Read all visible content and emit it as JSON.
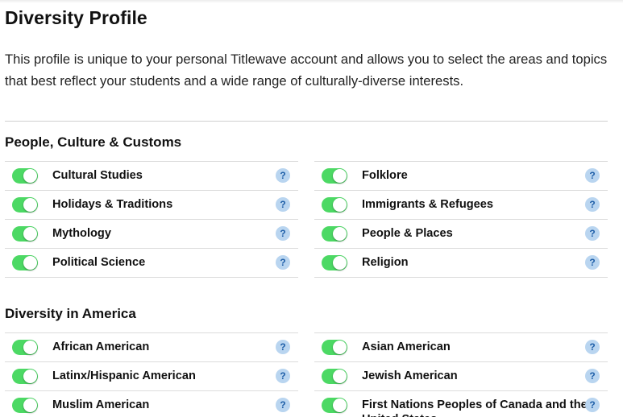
{
  "page": {
    "title": "Diversity Profile",
    "intro": "This profile is unique to your personal Titlewave account and allows you to select the areas and topics that best reflect your students and a wide range of culturally-diverse interests."
  },
  "colors": {
    "toggle_on": "#4cd964",
    "help_bg": "#b9d5f0",
    "help_fg": "#1f5fa8"
  },
  "icons": {
    "toggle": "toggle-switch-on",
    "help": "question-mark-icon"
  },
  "sections": [
    {
      "title": "People, Culture & Customs",
      "items": [
        {
          "label": "Cultural Studies",
          "enabled": true,
          "help": "?"
        },
        {
          "label": "Folklore",
          "enabled": true,
          "help": "?"
        },
        {
          "label": "Holidays & Traditions",
          "enabled": true,
          "help": "?"
        },
        {
          "label": "Immigrants & Refugees",
          "enabled": true,
          "help": "?"
        },
        {
          "label": "Mythology",
          "enabled": true,
          "help": "?"
        },
        {
          "label": "People & Places",
          "enabled": true,
          "help": "?"
        },
        {
          "label": "Political Science",
          "enabled": true,
          "help": "?"
        },
        {
          "label": "Religion",
          "enabled": true,
          "help": "?"
        }
      ]
    },
    {
      "title": "Diversity in America",
      "items": [
        {
          "label": "African American",
          "enabled": true,
          "help": "?"
        },
        {
          "label": "Asian American",
          "enabled": true,
          "help": "?"
        },
        {
          "label": "Latinx/Hispanic American",
          "enabled": true,
          "help": "?"
        },
        {
          "label": "Jewish American",
          "enabled": true,
          "help": "?"
        },
        {
          "label": "Muslim American",
          "enabled": true,
          "help": "?"
        },
        {
          "label": "First Nations Peoples of Canada and the United States",
          "enabled": true,
          "help": "?"
        }
      ]
    }
  ]
}
